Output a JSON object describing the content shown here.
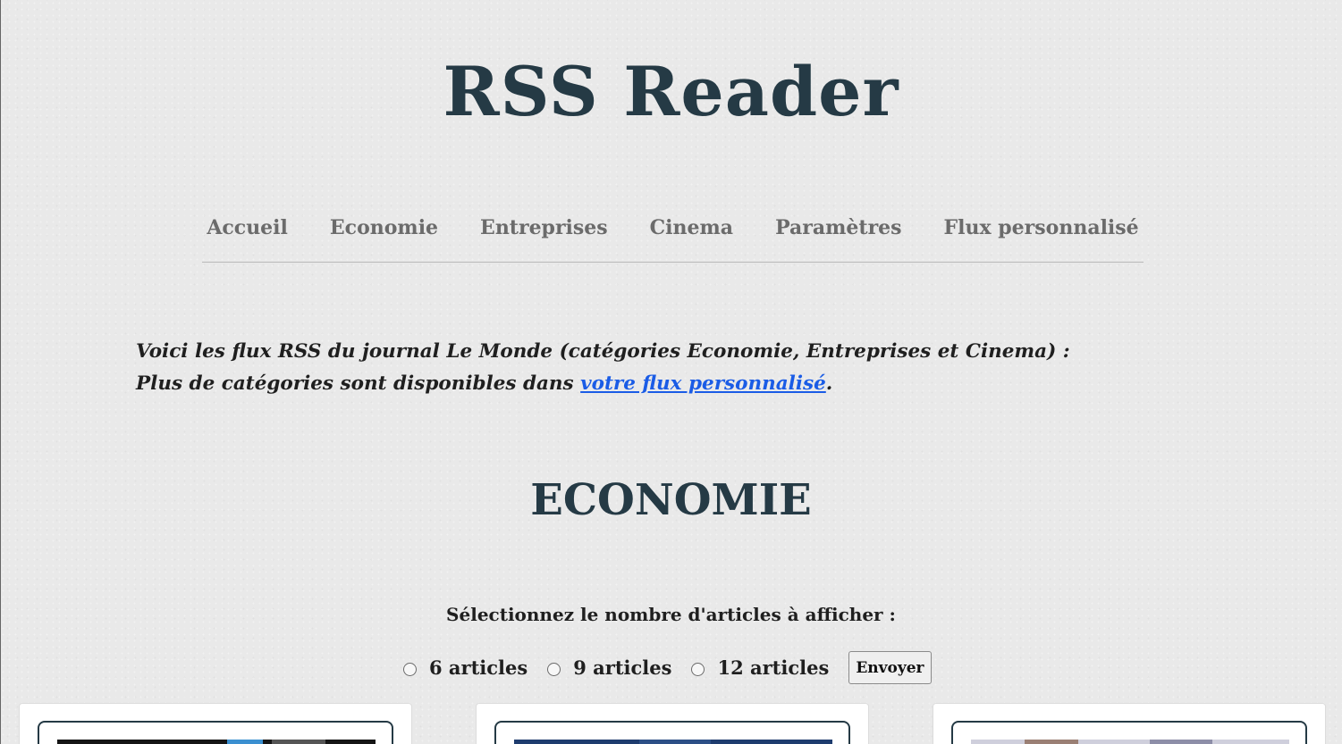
{
  "site": {
    "title": "RSS Reader"
  },
  "nav": {
    "items": [
      {
        "label": "Accueil"
      },
      {
        "label": "Economie"
      },
      {
        "label": "Entreprises"
      },
      {
        "label": "Cinema"
      },
      {
        "label": "Paramètres"
      },
      {
        "label": "Flux personnalisé"
      }
    ]
  },
  "intro": {
    "line1": "Voici les flux RSS du journal Le Monde (catégories Economie, Entreprises et Cinema) :",
    "line2_prefix": "Plus de catégories sont disponibles dans ",
    "link_text": "votre flux personnalisé",
    "line2_suffix": "."
  },
  "section": {
    "title": "ECONOMIE"
  },
  "selector": {
    "label": "Sélectionnez le nombre d'articles à afficher :",
    "options": [
      {
        "label": "6 articles",
        "checked": false
      },
      {
        "label": "9 articles",
        "checked": false
      },
      {
        "label": "12 articles",
        "checked": false
      }
    ],
    "submit_label": "Envoyer"
  },
  "colors": {
    "title": "#253a45",
    "nav_text": "#6b6b6b",
    "link": "#1a5ce6",
    "background": "#e9e9e9"
  }
}
